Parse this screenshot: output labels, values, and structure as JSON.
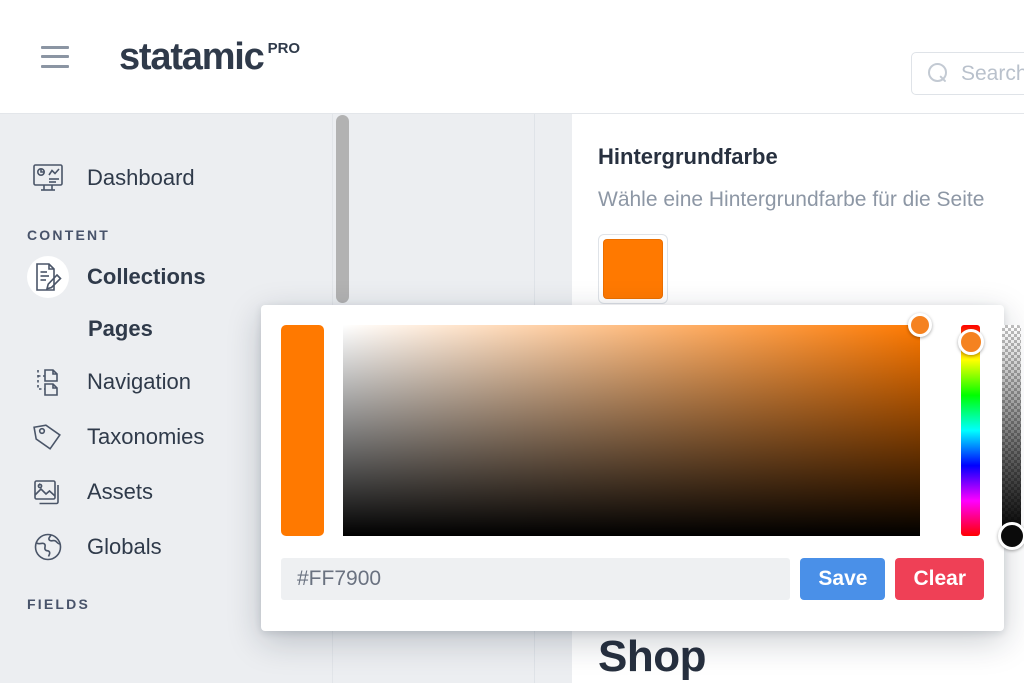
{
  "header": {
    "menu_icon": "hamburger-icon",
    "logo_word": "statamic",
    "logo_badge": "PRO",
    "search": {
      "icon": "search-icon",
      "placeholder": "Search...",
      "value": ""
    }
  },
  "sidebar": {
    "items": [
      {
        "label": "Dashboard",
        "icon": "dashboard-icon",
        "active": false,
        "sub": false
      },
      {
        "label": "Collections",
        "icon": "collections-icon",
        "active": true,
        "sub": false
      },
      {
        "label": "Pages",
        "icon": "",
        "active": false,
        "sub": true
      },
      {
        "label": "Navigation",
        "icon": "navigation-icon",
        "active": false,
        "sub": false
      },
      {
        "label": "Taxonomies",
        "icon": "tag-icon",
        "active": false,
        "sub": false
      },
      {
        "label": "Assets",
        "icon": "images-icon",
        "active": false,
        "sub": false
      },
      {
        "label": "Globals",
        "icon": "globe-icon",
        "active": false,
        "sub": false
      }
    ],
    "sections": {
      "content": "CONTENT",
      "fields": "FIELDS"
    }
  },
  "main": {
    "field_title": "Hintergrundfarbe",
    "field_description": "Wähle eine Hintergrundfarbe für die Seite",
    "swatch_color": "#FF7900",
    "section_heading": "Shop"
  },
  "color_picker": {
    "preview_color": "#FF7900",
    "hue_color": "#FF7900",
    "hex_value": "#FF7900",
    "hex_placeholder": "#FF7900",
    "save_label": "Save",
    "clear_label": "Clear",
    "save_color": "#4A90E8",
    "clear_color": "#EF4056",
    "hue_thumb_color": "#F58220",
    "alpha_thumb_color": "#0B0B0B"
  }
}
